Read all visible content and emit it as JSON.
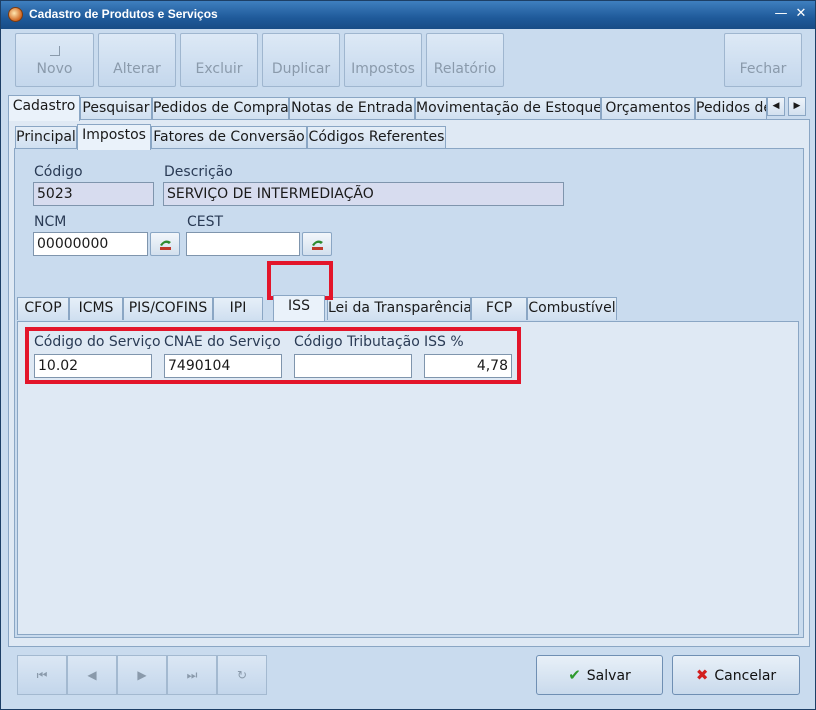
{
  "window": {
    "title": "Cadastro de Produtos e Serviços",
    "minimize": "—",
    "close": "✕"
  },
  "toolbar": {
    "novo": "Novo",
    "alterar": "Alterar",
    "excluir": "Excluir",
    "duplicar": "Duplicar",
    "impostos": "Impostos",
    "relatorio": "Relatório",
    "fechar": "Fechar"
  },
  "main_tabs": [
    "Cadastro",
    "Pesquisar",
    "Pedidos de Compra",
    "Notas de Entrada",
    "Movimentação de Estoque",
    "Orçamentos",
    "Pedidos de"
  ],
  "sub_tabs": [
    "Principal",
    "Impostos",
    "Fatores de Conversão",
    "Códigos Referentes"
  ],
  "form": {
    "codigo_label": "Código",
    "codigo_value": "5023",
    "descricao_label": "Descrição",
    "descricao_value": "SERVIÇO DE INTERMEDIAÇÃO",
    "ncm_label": "NCM",
    "ncm_value": "00000000",
    "cest_label": "CEST",
    "cest_value": ""
  },
  "tax_tabs": [
    "CFOP",
    "ICMS",
    "PIS/COFINS",
    "IPI",
    "ISS",
    "Lei da Transparência",
    "FCP",
    "Combustível"
  ],
  "iss": {
    "codigo_servico_label": "Código do Serviço",
    "codigo_servico_value": "10.02",
    "cnae_label": "CNAE do Serviço",
    "cnae_value": "7490104",
    "codigo_tributacao_label": "Código Tributação",
    "codigo_tributacao_value": "",
    "iss_pct_label": "ISS %",
    "iss_pct_value": "4,78"
  },
  "nav": {
    "first": "⏮",
    "prev": "◀",
    "next": "▶",
    "last": "⏭",
    "refresh": "↻"
  },
  "actions": {
    "salvar": "Salvar",
    "cancelar": "Cancelar"
  },
  "colors": {
    "highlight": "#e3152a",
    "titlebar": "#1f5a9a",
    "salvar_icon": "#2e9a2e",
    "cancelar_icon": "#d21f1f"
  }
}
